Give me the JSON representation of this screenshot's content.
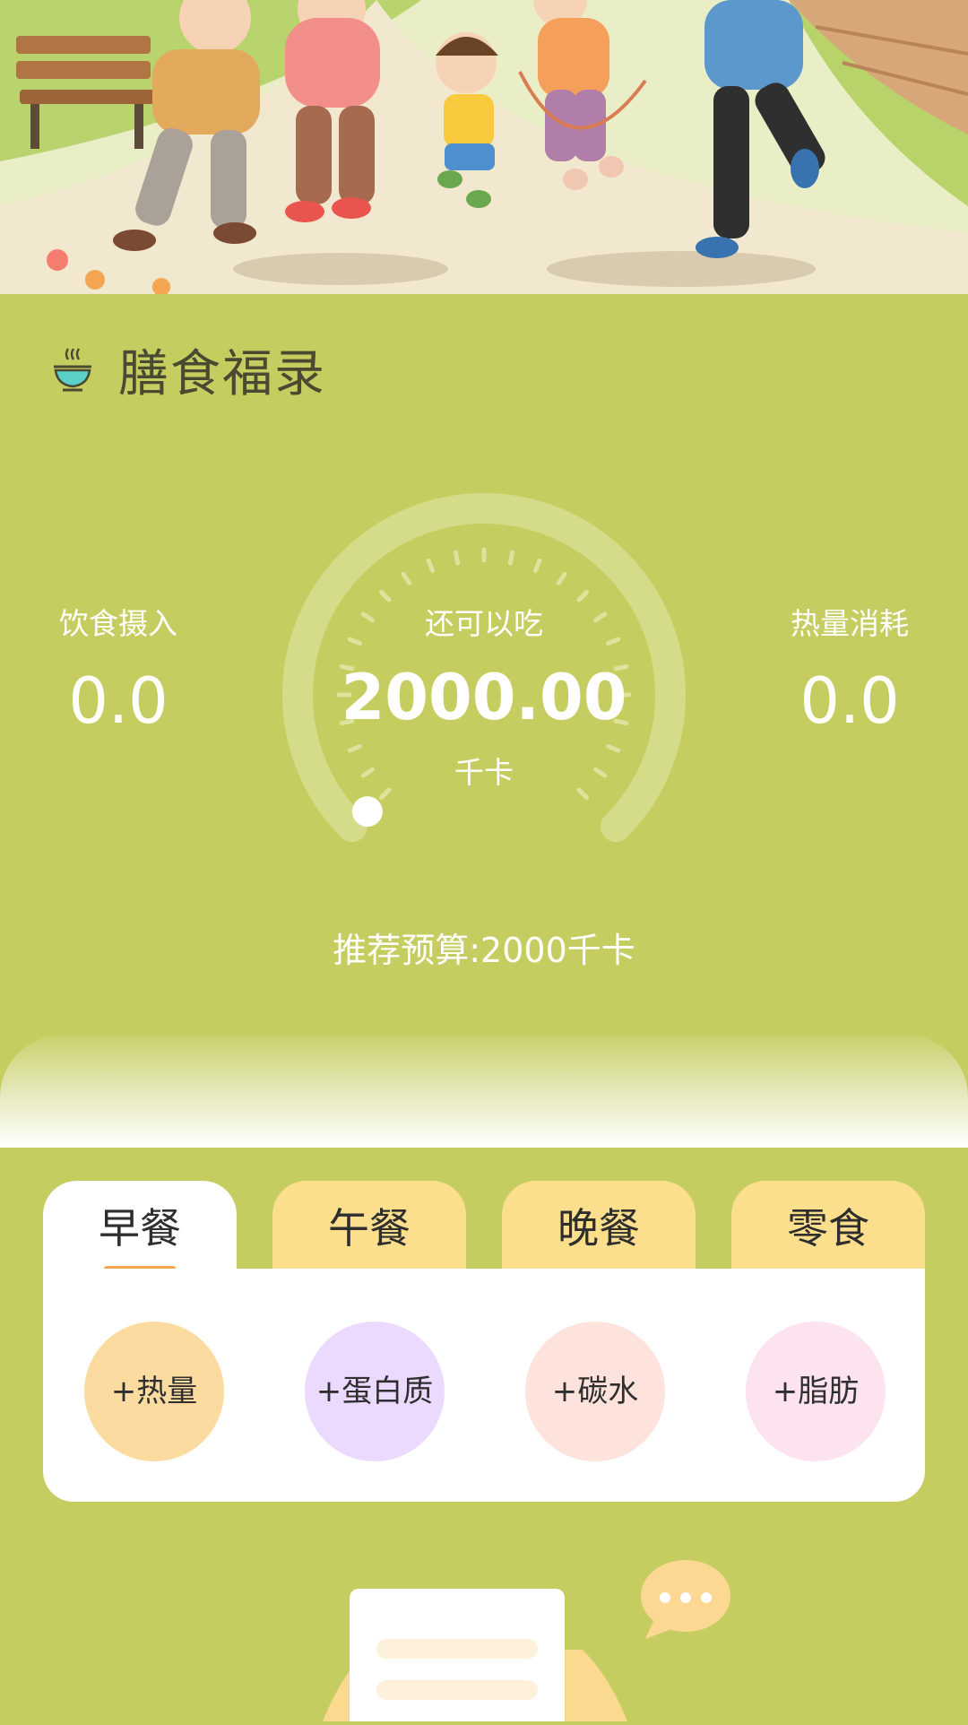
{
  "app": {
    "title": "膳食福录"
  },
  "stats": {
    "intake_label": "饮食摄入",
    "intake_value": "0.0",
    "burn_label": "热量消耗",
    "burn_value": "0.0"
  },
  "gauge": {
    "label": "还可以吃",
    "value": "2000.00",
    "unit": "千卡",
    "progress": 0
  },
  "budget_text": "推荐预算:2000千卡",
  "tabs": [
    {
      "label": "早餐",
      "active": true
    },
    {
      "label": "午餐",
      "active": false
    },
    {
      "label": "晚餐",
      "active": false
    },
    {
      "label": "零食",
      "active": false
    }
  ],
  "nutrients": [
    {
      "label": "+热量",
      "color": "#fcdba1"
    },
    {
      "label": "+蛋白质",
      "color": "#ebdafd"
    },
    {
      "label": "+碳水",
      "color": "#fde3dc"
    },
    {
      "label": "+脂肪",
      "color": "#fde3f0"
    }
  ],
  "colors": {
    "background": "#c6cd60",
    "tab_inactive": "#fbdf8d",
    "tab_indicator": "#f3a64c",
    "gauge_knob": "#ffffff"
  },
  "icons": {
    "logo": "food-bowl-icon",
    "chat": "chat-bubble-icon"
  }
}
